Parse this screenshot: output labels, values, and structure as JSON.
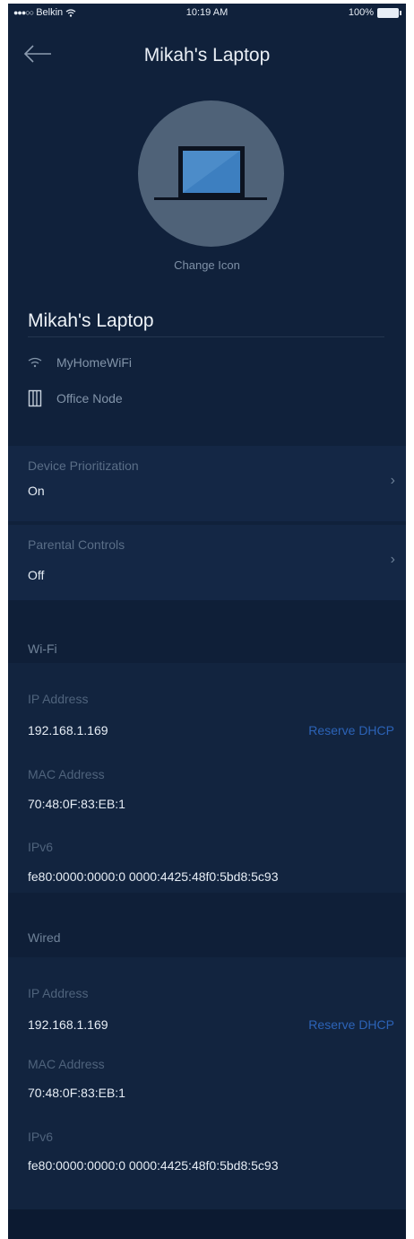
{
  "status_bar": {
    "carrier": "Belkin",
    "time": "10:19 AM",
    "battery": "100%"
  },
  "header": {
    "title": "Mikah's Laptop",
    "back_icon": "arrow-left-icon"
  },
  "device": {
    "icon": "laptop-icon",
    "change_icon_label": "Change Icon",
    "name": "Mikah's Laptop",
    "network_icon": "wifi-icon",
    "network": "MyHomeWiFi",
    "node_icon": "node-icon",
    "node": "Office Node"
  },
  "settings": [
    {
      "label": "Device Prioritization",
      "value": "On"
    },
    {
      "label": "Parental Controls",
      "value": "Off"
    }
  ],
  "wifi": {
    "header": "Wi-Fi",
    "ip_label": "IP Address",
    "ip_value": "192.168.1.169",
    "reserve_label": "Reserve DHCP",
    "mac_label": "MAC Address",
    "mac_value": "70:48:0F:83:EB:1",
    "ipv6_label": "IPv6",
    "ipv6_value": "fe80:0000:0000:0 0000:4425:48f0:5bd8:5c93"
  },
  "wired": {
    "header": "Wired",
    "ip_label": "IP Address",
    "ip_value": "192.168.1.169",
    "reserve_label": "Reserve DHCP",
    "mac_label": "MAC Address",
    "mac_value": "70:48:0F:83:EB:1",
    "ipv6_label": "IPv6",
    "ipv6_value": "fe80:0000:0000:0 0000:4425:48f0:5bd8:5c93"
  },
  "colors": {
    "background": "#10213b",
    "link": "#2c63b7"
  }
}
